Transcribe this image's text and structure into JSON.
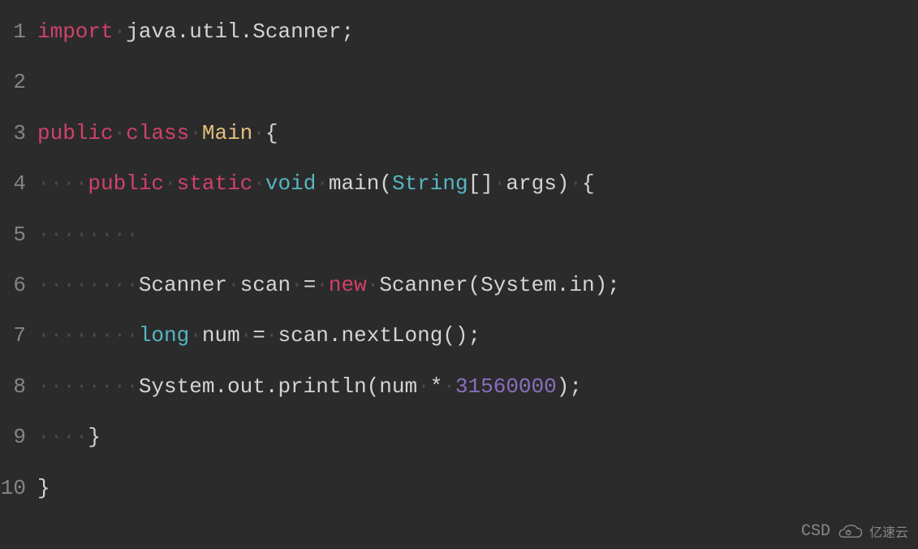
{
  "code": {
    "lines": [
      {
        "num": "1",
        "tokens": [
          {
            "text": "import",
            "cls": "keyword-import"
          },
          {
            "text": "·",
            "cls": "whitespace-dot"
          },
          {
            "text": "java.util.Scanner;",
            "cls": "text-normal"
          }
        ]
      },
      {
        "num": "2",
        "tokens": []
      },
      {
        "num": "3",
        "tokens": [
          {
            "text": "public",
            "cls": "keyword-public"
          },
          {
            "text": "·",
            "cls": "whitespace-dot"
          },
          {
            "text": "class",
            "cls": "keyword-class"
          },
          {
            "text": "·",
            "cls": "whitespace-dot"
          },
          {
            "text": "Main",
            "cls": "class-name"
          },
          {
            "text": "·",
            "cls": "whitespace-dot"
          },
          {
            "text": "{",
            "cls": "brackets"
          }
        ]
      },
      {
        "num": "4",
        "tokens": [
          {
            "text": "····",
            "cls": "whitespace-dot"
          },
          {
            "text": "public",
            "cls": "keyword-public"
          },
          {
            "text": "·",
            "cls": "whitespace-dot"
          },
          {
            "text": "static",
            "cls": "keyword-static"
          },
          {
            "text": "·",
            "cls": "whitespace-dot"
          },
          {
            "text": "void",
            "cls": "keyword-void"
          },
          {
            "text": "·",
            "cls": "whitespace-dot"
          },
          {
            "text": "main(",
            "cls": "text-normal"
          },
          {
            "text": "String",
            "cls": "type-string"
          },
          {
            "text": "[]",
            "cls": "brackets"
          },
          {
            "text": "·",
            "cls": "whitespace-dot"
          },
          {
            "text": "args)",
            "cls": "text-normal"
          },
          {
            "text": "·",
            "cls": "whitespace-dot"
          },
          {
            "text": "{",
            "cls": "brackets"
          }
        ]
      },
      {
        "num": "5",
        "tokens": [
          {
            "text": "········",
            "cls": "whitespace-dot"
          }
        ]
      },
      {
        "num": "6",
        "tokens": [
          {
            "text": "········",
            "cls": "whitespace-dot"
          },
          {
            "text": "Scanner",
            "cls": "text-normal"
          },
          {
            "text": "·",
            "cls": "whitespace-dot"
          },
          {
            "text": "scan",
            "cls": "text-normal"
          },
          {
            "text": "·",
            "cls": "whitespace-dot"
          },
          {
            "text": "=",
            "cls": "text-normal"
          },
          {
            "text": "·",
            "cls": "whitespace-dot"
          },
          {
            "text": "new",
            "cls": "keyword-new"
          },
          {
            "text": "·",
            "cls": "whitespace-dot"
          },
          {
            "text": "Scanner(System.in);",
            "cls": "text-normal"
          }
        ]
      },
      {
        "num": "7",
        "tokens": [
          {
            "text": "········",
            "cls": "whitespace-dot"
          },
          {
            "text": "long",
            "cls": "type-long"
          },
          {
            "text": "·",
            "cls": "whitespace-dot"
          },
          {
            "text": "num",
            "cls": "text-normal"
          },
          {
            "text": "·",
            "cls": "whitespace-dot"
          },
          {
            "text": "=",
            "cls": "text-normal"
          },
          {
            "text": "·",
            "cls": "whitespace-dot"
          },
          {
            "text": "scan.nextLong();",
            "cls": "text-normal"
          }
        ]
      },
      {
        "num": "8",
        "tokens": [
          {
            "text": "········",
            "cls": "whitespace-dot"
          },
          {
            "text": "System.out.println(num",
            "cls": "text-normal"
          },
          {
            "text": "·",
            "cls": "whitespace-dot"
          },
          {
            "text": "*",
            "cls": "text-normal"
          },
          {
            "text": "·",
            "cls": "whitespace-dot"
          },
          {
            "text": "31560000",
            "cls": "number-literal"
          },
          {
            "text": ");",
            "cls": "text-normal"
          }
        ]
      },
      {
        "num": "9",
        "tokens": [
          {
            "text": "····",
            "cls": "whitespace-dot"
          },
          {
            "text": "}",
            "cls": "brackets"
          }
        ]
      },
      {
        "num": "10",
        "tokens": [
          {
            "text": "}",
            "cls": "brackets"
          }
        ]
      }
    ]
  },
  "watermark": {
    "text1": "CSD",
    "text2": "亿速云"
  }
}
